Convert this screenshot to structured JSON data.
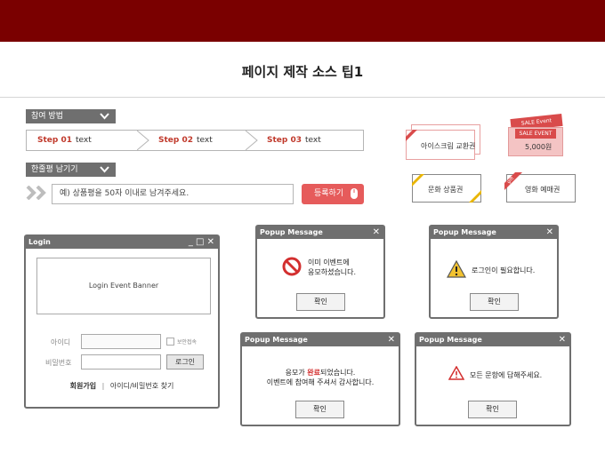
{
  "page": {
    "title": "페이지 제작 소스 팁1"
  },
  "participation": {
    "label": "참여 방법",
    "steps": [
      {
        "num": "Step 01",
        "text": "text"
      },
      {
        "num": "Step 02",
        "text": "text"
      },
      {
        "num": "Step 03",
        "text": "text"
      }
    ]
  },
  "review": {
    "label": "한줄평 남기기",
    "placeholder": "예) 상품평을 50자 이내로 남겨주세요.",
    "submit_label": "등록하기"
  },
  "coupons": {
    "icecream": "아이스크림 교환권",
    "sale_top": "SALE Event",
    "sale_event": "SALE EVENT",
    "sale_amount": "5,000원",
    "culture": "문화 상품권",
    "gift_tag": "gift",
    "movie": "영화 예매권"
  },
  "login": {
    "window_title": "Login",
    "window_controls": "_ □ ✕",
    "banner": "Login Event Banner",
    "id_label": "아이디",
    "pw_label": "비밀번호",
    "secure_label": "보안접속",
    "login_button": "로그인",
    "signup": "회원가입",
    "separator": "|",
    "find": "아이디/비밀번호 찾기"
  },
  "popups": [
    {
      "title": "Popup Message",
      "close": "✕",
      "line1": "이미 이벤트에",
      "line2": "응모하셨습니다.",
      "ok": "확인"
    },
    {
      "title": "Popup Message",
      "close": "✕",
      "line1": "로그인이 필요합니다.",
      "ok": "확인"
    },
    {
      "title": "Popup Message",
      "close": "✕",
      "line1_pre": "응모가 ",
      "line1_highlight": "완료",
      "line1_post": "되었습니다.",
      "line2": "이벤트에 참여해 주셔서 감사합니다.",
      "ok": "확인"
    },
    {
      "title": "Popup Message",
      "close": "✕",
      "line1": "모든 문항에 답해주세요.",
      "ok": "확인"
    }
  ],
  "colors": {
    "topbar": "#7a0000",
    "accent": "#c0392b",
    "button_red": "#e65b5b",
    "window_gray": "#6f6f6f"
  }
}
